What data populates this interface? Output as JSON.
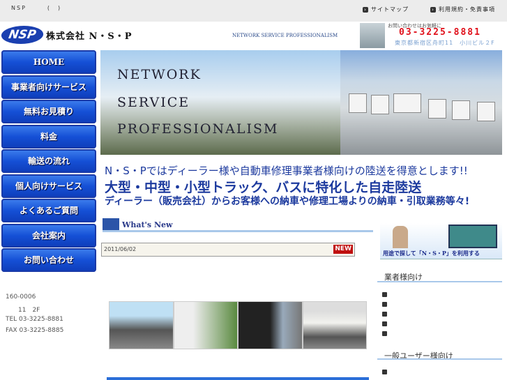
{
  "topbar": {
    "site_title": "NSP　　　(　)",
    "links": [
      "サイトマップ",
      "利用規約・免責事項"
    ]
  },
  "header": {
    "logo": "NSP",
    "company": "株式会社 N・S・P",
    "tagline": "NETWORK SERVICE PROFESSIONALISM",
    "contact_prompt": "お問い合わせはお気軽に",
    "phone": "03-3225-8881",
    "address": "東京都新宿区舟町11　小川ビル２F"
  },
  "nav": [
    "HOME",
    "事業者向けサービス",
    "無料お見積り",
    "料金",
    "輸送の流れ",
    "個人向けサービス",
    "よくあるご質問",
    "会社案内",
    "お問い合わせ"
  ],
  "hero": {
    "lines": [
      "NETWORK",
      "SERVICE",
      "PROFESSIONALISM"
    ]
  },
  "headlines": [
    "N・S・Pではディーラー様や自動車修理事業者様向けの陸送を得意とします!!",
    "大型・中型・小型トラック、バスに特化した自走陸送",
    "ディーラー（販売会社）からお客様への納車や修理工場よりの納車・引取業務等々!"
  ],
  "whats_new": {
    "title": "What's New",
    "items": [
      {
        "date": "2011/06/02",
        "badge": "NEW"
      }
    ]
  },
  "banner": {
    "text": "用途で探して「N・S・P」を利用する"
  },
  "sidebar": {
    "business_heading": "業者様向け",
    "general_heading": "一般ユーザー様向け"
  },
  "company_info": {
    "postal": "160-0006",
    "address": "11　2F",
    "tel": "TEL 03-3225-8881",
    "fax": "FAX 03-3225-8885"
  },
  "colors": {
    "nav_blue": "#1550d6",
    "phone_red": "#e0101a",
    "headline_blue": "#1c3a9e"
  }
}
